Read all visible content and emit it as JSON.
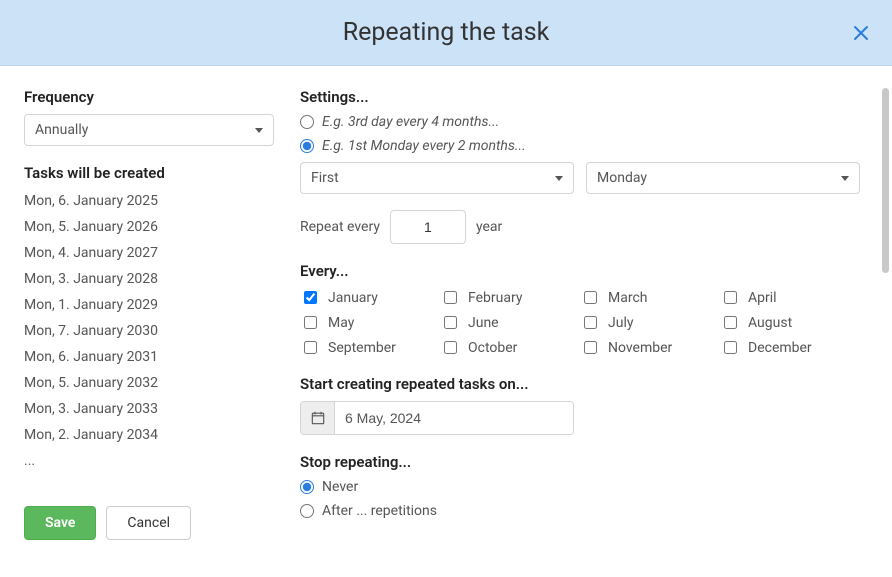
{
  "header": {
    "title": "Repeating the task"
  },
  "left": {
    "frequency_label": "Frequency",
    "frequency_value": "Annually",
    "preview_header": "Tasks will be created",
    "preview_items": [
      "Mon, 6. January 2025",
      "Mon, 5. January 2026",
      "Mon, 4. January 2027",
      "Mon, 3. January 2028",
      "Mon, 1. January 2029",
      "Mon, 7. January 2030",
      "Mon, 6. January 2031",
      "Mon, 5. January 2032",
      "Mon, 3. January 2033",
      "Mon, 2. January 2034",
      "..."
    ],
    "save_label": "Save",
    "cancel_label": "Cancel"
  },
  "settings": {
    "header": "Settings...",
    "option_a_label": "E.g. 3rd day every 4 months...",
    "option_b_label": "E.g. 1st Monday every 2 months...",
    "selected_option": "b",
    "ordinal_value": "First",
    "weekday_value": "Monday",
    "repeat_every_label": "Repeat every",
    "repeat_every_value": "1",
    "repeat_unit_label": "year"
  },
  "every": {
    "header": "Every...",
    "months": [
      {
        "name": "January",
        "checked": true
      },
      {
        "name": "February",
        "checked": false
      },
      {
        "name": "March",
        "checked": false
      },
      {
        "name": "April",
        "checked": false
      },
      {
        "name": "May",
        "checked": false
      },
      {
        "name": "June",
        "checked": false
      },
      {
        "name": "July",
        "checked": false
      },
      {
        "name": "August",
        "checked": false
      },
      {
        "name": "September",
        "checked": false
      },
      {
        "name": "October",
        "checked": false
      },
      {
        "name": "November",
        "checked": false
      },
      {
        "name": "December",
        "checked": false
      }
    ]
  },
  "start": {
    "header": "Start creating repeated tasks on...",
    "date_value": "6 May, 2024"
  },
  "stop": {
    "header": "Stop repeating...",
    "never_label": "Never",
    "after_label": "After ... repetitions",
    "selected": "never"
  }
}
